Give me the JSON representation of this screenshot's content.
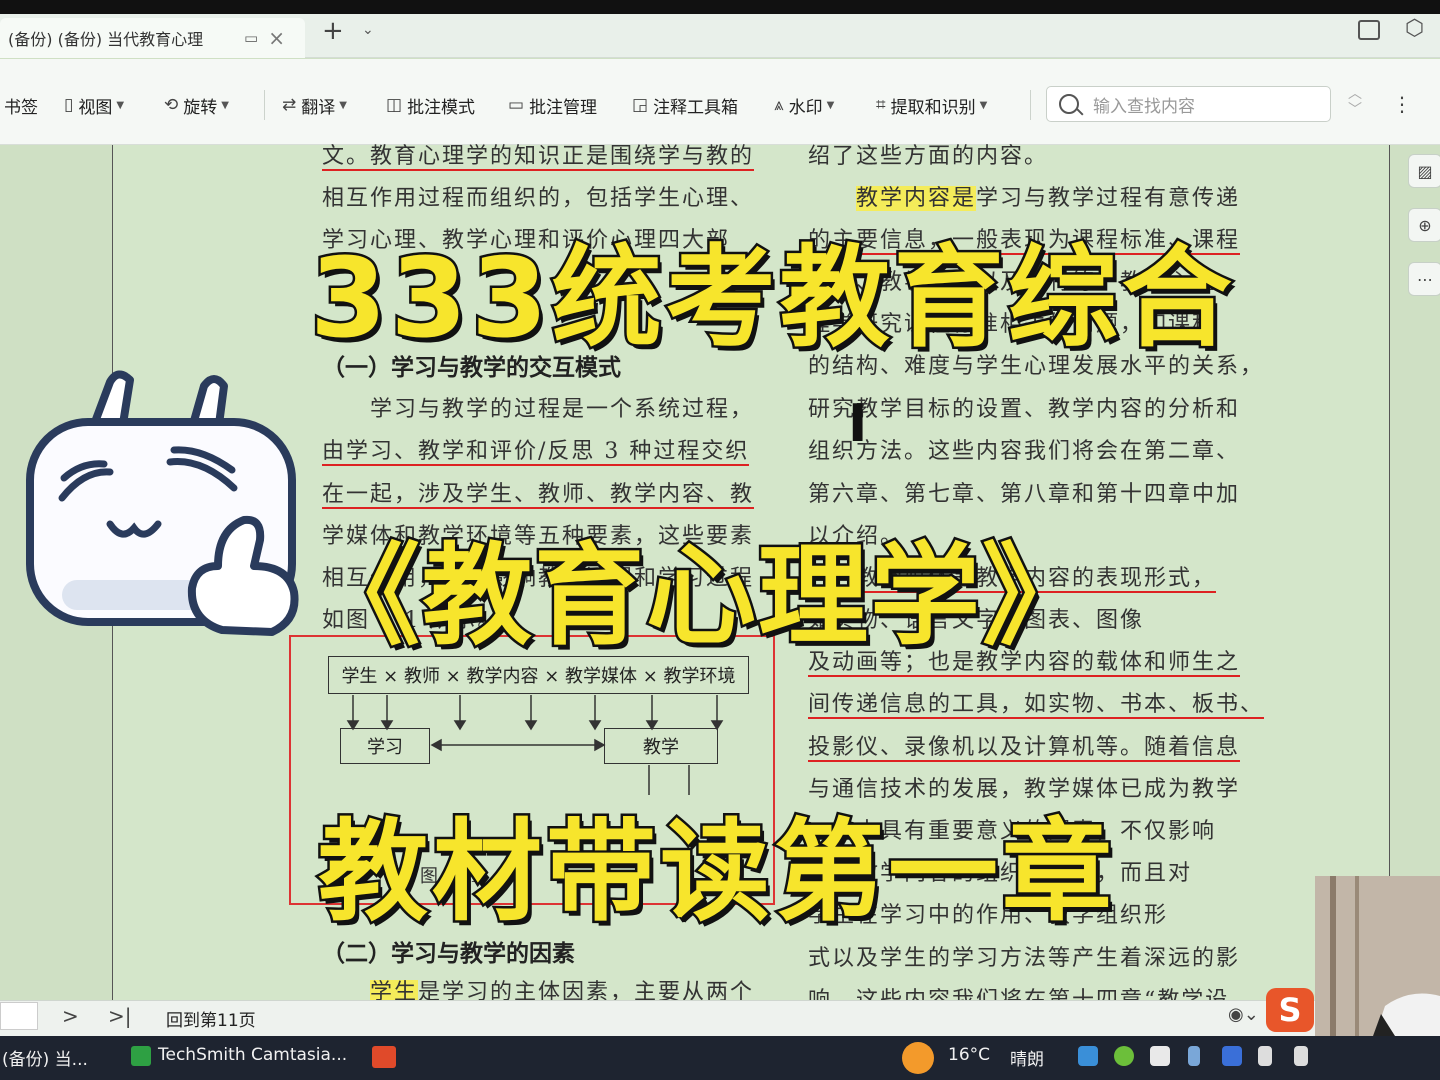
{
  "tabs": {
    "active": "(备份) (备份) 当代教育心理",
    "add": "+",
    "more": "⌄"
  },
  "toolbar": {
    "bookmark": "书签",
    "view": "视图",
    "rotate": "旋转",
    "translate": "翻译",
    "annotation_mode": "批注模式",
    "annotation_manage": "批注管理",
    "annotation_tools": "注释工具箱",
    "watermark": "水印",
    "extract": "提取和识别",
    "search_placeholder": "输入查找内容"
  },
  "doc": {
    "left": {
      "l1": "文。教育心理学的知识正是围绕学与教的",
      "l2": "相互作用过程而组织的，包括学生心理、",
      "l3": "学习心理、教学心理和评价心理四大部",
      "heading1": "（一）学习与教学的交互模式",
      "l4": "学习与教学的过程是一个系统过程，",
      "l5": "由学习、教学和评价/反思 3 种过程交织",
      "l6": "在一起，涉及学生、教师、教学内容、教",
      "l7": "学媒体和教学环境等五种要素，这些要素",
      "l8": "相互作用，共同影响教学过程和学习过程",
      "l9": "如图 1-1 所示。",
      "heading2": "（二）学习与教学的因素",
      "l10_hl": "学生",
      "l10": "是学习的主体因素，主要从两个"
    },
    "right": {
      "r1": "绍了这些方面的内容。",
      "r2_hl": "教学内容是",
      "r2": "学习与教学过程有意传递",
      "r3": "的主要信息，一般表现为课程标准、课程",
      "r4": "计划、教学目标以及教材等。教育心理",
      "r5": "理学研究课程标准相关的问题，如课程",
      "r6": "的结构、难度与学生心理发展水平的关系，",
      "r7": "研究教学目标的设置、教学内容的分析和",
      "r8": "组织方法。这些内容我们将会在第二章、",
      "r9": "第六章、第七章、第八章和第十四章中加",
      "r10": "以介绍。",
      "r11": "教学媒体是教学内容的表现形式，",
      "r12": "如实物、语言文字、图表、图像",
      "r13": "及动画等；也是教学内容的载体和师生之",
      "r14": "间传递信息的工具，如实物、书本、板书、",
      "r15": "投影仪、录像机以及计算机等。随着信息",
      "r16": "与通信技术的发展，教学媒体已成为教学",
      "r17": "中具有重要意义的因素，不仅影响",
      "r18": "教学内容的组织和呈现，而且对",
      "r19": "学生在学习中的作用、教学组织形",
      "r20": "式以及学生的学习方法等产生着深远的影",
      "r21": "响。这些内容我们将在第十四章“教学设"
    },
    "diagram": {
      "top": "学生 × 教师 × 教学内容 × 教学媒体 × 教学环境",
      "learn": "学习",
      "teach": "教学",
      "caption": "图 1-1"
    }
  },
  "overlay": {
    "title1": "333统考教育综合",
    "title2": "《教育心理学》",
    "title3": "教材带读第一章"
  },
  "statusbar": {
    "back_to": "回到第11页",
    "next": ">",
    "last": ">|"
  },
  "taskbar": {
    "item1": "(备份) 当...",
    "item2": "TechSmith Camtasia...",
    "temp": "16°C",
    "weather": "晴朗"
  },
  "sogou": "S"
}
